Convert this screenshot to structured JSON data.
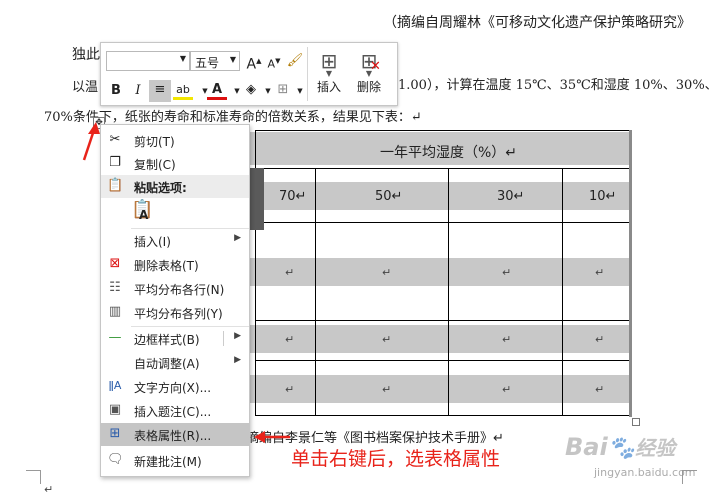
{
  "document": {
    "citation_top": "（摘编自周耀林《可移动文化遗产保护策略研究》",
    "para1_start": "独此",
    "para2_start": "以温",
    "para2_right": "1.00），计算在温度 15℃、35℃和湿度 10%、30%、",
    "para3": "70%条件下，纸张的寿命和标准寿命的倍数关系，结果见下表：↵",
    "citation_bottom": "摘编自李景仁等《图书档案保护技术手册》↵",
    "table": {
      "header": "一年平均湿度（%）↵",
      "columns": [
        "70↵",
        "50↵",
        "30↵",
        "10↵"
      ],
      "cell_mark": "↵"
    }
  },
  "mini_toolbar": {
    "font_name": "",
    "font_size": "五号",
    "insert_label": "插入",
    "delete_label": "删除"
  },
  "context_menu": {
    "items": [
      {
        "label": "剪切(T)",
        "icon": "scissors-icon"
      },
      {
        "label": "复制(C)",
        "icon": "copy-icon"
      },
      {
        "label": "粘贴选项:",
        "icon": "paste-icon"
      },
      {
        "label": "插入(I)",
        "icon": ""
      },
      {
        "label": "删除表格(T)",
        "icon": "delete-table-icon"
      },
      {
        "label": "平均分布各行(N)",
        "icon": "distribute-rows-icon"
      },
      {
        "label": "平均分布各列(Y)",
        "icon": "distribute-columns-icon"
      },
      {
        "label": "边框样式(B)",
        "icon": "border-style-icon"
      },
      {
        "label": "自动调整(A)",
        "icon": ""
      },
      {
        "label": "文字方向(X)...",
        "icon": "text-direction-icon"
      },
      {
        "label": "插入题注(C)...",
        "icon": "insert-caption-icon"
      },
      {
        "label": "表格属性(R)...",
        "icon": "table-properties-icon"
      },
      {
        "label": "新建批注(M)",
        "icon": "new-comment-icon"
      }
    ]
  },
  "annotation": {
    "text": "单击右键后，选表格属性",
    "color": "#e8231a"
  },
  "watermark": {
    "brand": "Bai",
    "brand2": "经验",
    "url": "jingyan.baidu.com"
  }
}
